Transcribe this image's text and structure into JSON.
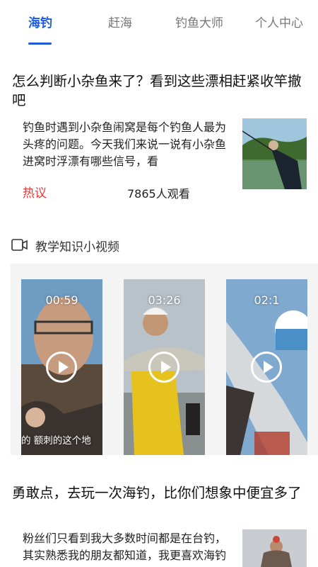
{
  "tabs": [
    {
      "label": "海钓",
      "active": true
    },
    {
      "label": "赶海",
      "active": false
    },
    {
      "label": "钓鱼大师",
      "active": false
    },
    {
      "label": "个人中心",
      "active": false
    }
  ],
  "colors": {
    "accent": "#1e5bd8",
    "hot": "#e53a3a"
  },
  "articles": [
    {
      "title": "怎么判断小杂鱼来了？看到这些漂相赶紧收竿撤吧",
      "desc": "钓鱼时遇到小杂鱼闹窝是每个钓鱼人最为头疼的问题。今天我们来说一说有小杂鱼进窝时浮漂有哪些信号，看",
      "tag": "热议",
      "views": "7865人观看",
      "thumb_icon": "fishing-photo"
    },
    {
      "title": "勇敢点，去玩一次海钓，比你们想象中便宜多了",
      "desc": "粉丝们只看到我大多数时间都是在台钓，其实熟悉我的朋友都知道，我更喜欢海钓",
      "thumb_icon": "fishing-photo"
    }
  ],
  "videos_section": {
    "title": "教学知识小视频",
    "icon": "video-camera-icon",
    "videos": [
      {
        "duration": "00:59",
        "caption": "的  额刺的这个地"
      },
      {
        "duration": "03:26",
        "caption": ""
      },
      {
        "duration": "02:1",
        "caption": ""
      }
    ]
  }
}
